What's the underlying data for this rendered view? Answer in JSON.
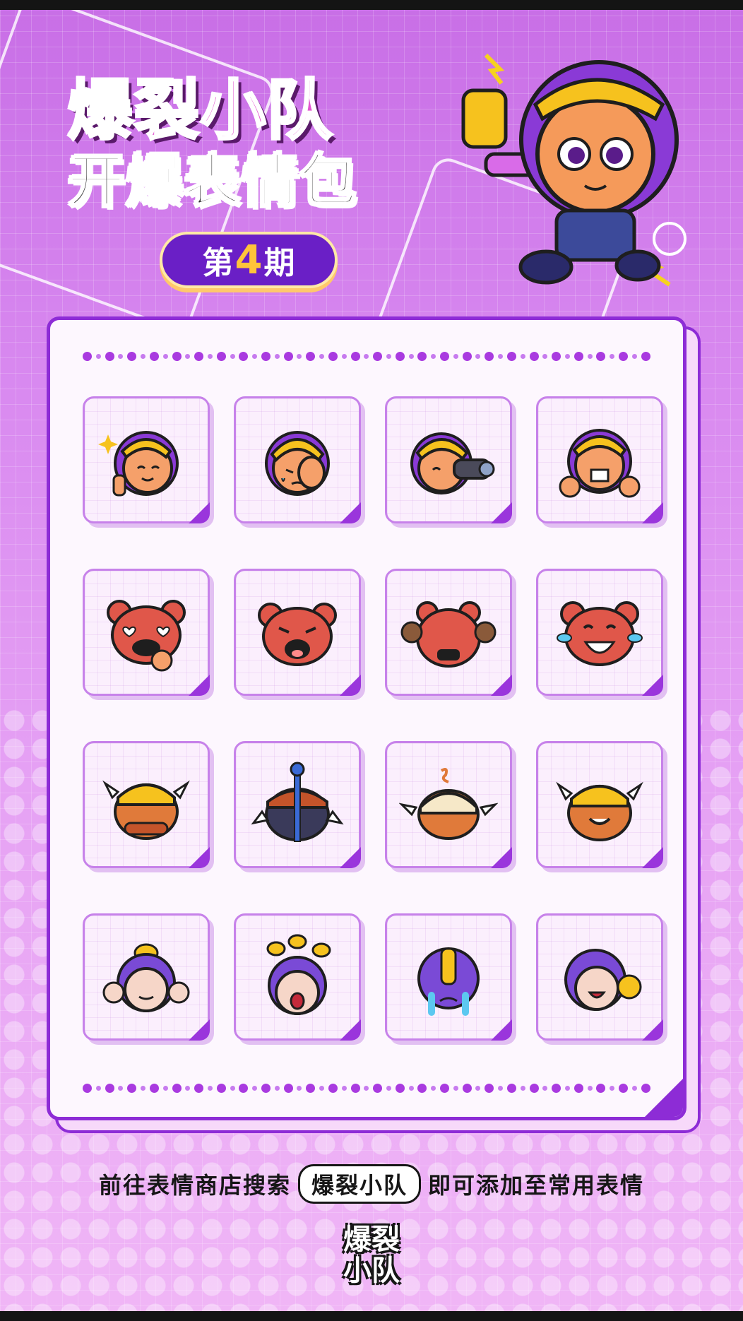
{
  "header": {
    "title_line1": "爆裂小队",
    "title_line2": "开爆表情包",
    "issue_prefix": "第",
    "issue_number": "4",
    "issue_suffix": "期"
  },
  "colors": {
    "accent_purple": "#8d2cd6",
    "title_pink": "#e357cf",
    "pill_purple": "#6a1fc6",
    "number_yellow": "#ffc43a"
  },
  "stickers": [
    {
      "icon": "shelly-peace-wink-icon"
    },
    {
      "icon": "shelly-facepalm-icon"
    },
    {
      "icon": "shelly-binoculars-icon"
    },
    {
      "icon": "shelly-grin-thumbs-icon"
    },
    {
      "icon": "bear-heart-eyes-icon"
    },
    {
      "icon": "bear-crying-icon"
    },
    {
      "icon": "bear-hands-up-icon"
    },
    {
      "icon": "bear-laugh-tears-icon"
    },
    {
      "icon": "winged-helmet-arms-crossed-icon"
    },
    {
      "icon": "winged-helmet-scepter-icon"
    },
    {
      "icon": "winged-helmet-sleeping-icon"
    },
    {
      "icon": "winged-helmet-giggle-icon"
    },
    {
      "icon": "bee-hood-flex-icon"
    },
    {
      "icon": "bee-hood-shouting-icon"
    },
    {
      "icon": "bee-hood-crying-icon"
    },
    {
      "icon": "bee-hood-laughing-icon"
    }
  ],
  "footer": {
    "text_before": "前往表情商店搜索",
    "search_tag": "爆裂小队",
    "text_after": "即可添加至常用表情",
    "logo_line1": "爆裂",
    "logo_line2": "小队"
  }
}
